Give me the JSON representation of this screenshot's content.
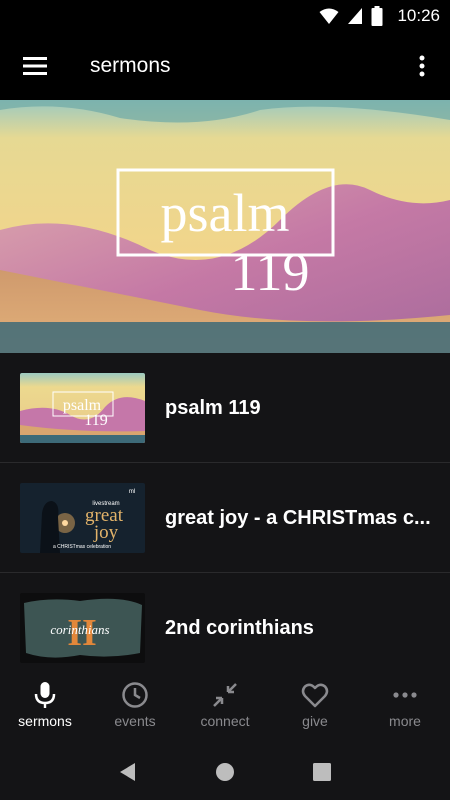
{
  "status": {
    "time": "10:26"
  },
  "appbar": {
    "title": "sermons"
  },
  "hero": {
    "line1": "psalm",
    "line2": "119"
  },
  "sermons": [
    {
      "title": "psalm 119",
      "thumb_line1": "psalm",
      "thumb_line2": "119"
    },
    {
      "title": "great joy - a CHRISTmas c...",
      "thumb_top": "livestream",
      "thumb_big1": "great",
      "thumb_big2": "joy",
      "thumb_sub": "a CHRISTmas celebration",
      "thumb_badge": "ml"
    },
    {
      "title": "2nd corinthians",
      "thumb_numeral": "II",
      "thumb_word": "corinthians"
    }
  ],
  "nav": [
    {
      "label": "sermons",
      "icon": "microphone-icon",
      "active": true
    },
    {
      "label": "events",
      "icon": "clock-icon",
      "active": false
    },
    {
      "label": "connect",
      "icon": "connect-arrows-icon",
      "active": false
    },
    {
      "label": "give",
      "icon": "heart-icon",
      "active": false
    },
    {
      "label": "more",
      "icon": "more-horizontal-icon",
      "active": false
    }
  ],
  "colors": {
    "background": "#141416",
    "accent_orange": "#e2873a",
    "active": "#ffffff",
    "inactive": "#8a8a8e"
  }
}
